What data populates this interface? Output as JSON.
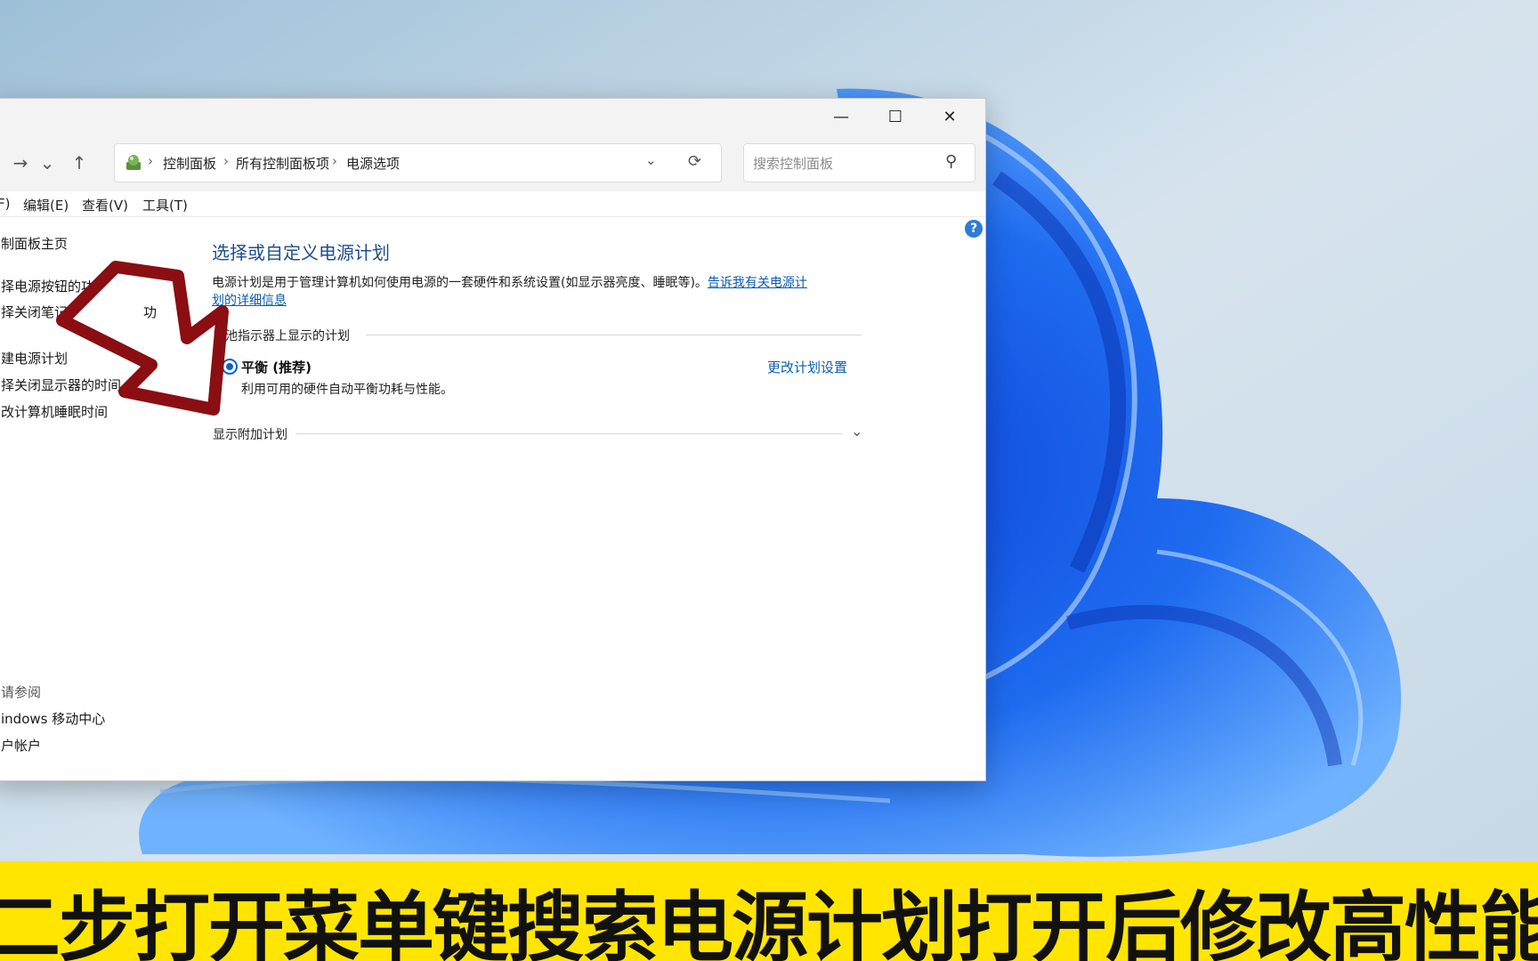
{
  "window": {
    "controls": {
      "minimize": "—",
      "maximize": "☐",
      "close": "✕"
    }
  },
  "nav": {
    "forward": "→",
    "recent": "⌄",
    "up": "↑",
    "address": [
      "控制面板",
      "所有控制面板项",
      "电源选项"
    ],
    "address_sep": "›",
    "dropdown": "⌄",
    "refresh": "⟳",
    "search_placeholder": "搜索控制面板",
    "search_icon": "⚲"
  },
  "menubar": {
    "file_partial": "F)",
    "edit": "编辑(E)",
    "view": "查看(V)",
    "tools": "工具(T)"
  },
  "sidebar": {
    "home": "制面板主页",
    "items": [
      "择电源按钮的功",
      "择关闭笔记",
      "",
      "建电源计划",
      "择关闭显示器的时间",
      "改计算机睡眠时间"
    ],
    "item2_tail": "功",
    "item3_tail": "",
    "see_also_title": "请参阅",
    "see_also": [
      "indows 移动中心",
      "户帐户"
    ]
  },
  "main": {
    "title": "选择或自定义电源计划",
    "desc_line1": "电源计划是用于管理计算机如何使用电源的一套硬件和系统设置(如显示器亮度、睡眠等)。",
    "desc_link1": "告诉我有关电源计",
    "desc_link2": "划的详细信息",
    "battery_group": "电池指示器上显示的计划",
    "plan_name": "平衡 (推荐)",
    "plan_desc": "利用可用的硬件自动平衡功耗与性能。",
    "plan_link": "更改计划设置",
    "additional_group": "显示附加计划",
    "expand_icon": "⌄",
    "help": "?"
  },
  "caption": {
    "text": "二步打开菜单键搜索电源计划打开后修改高性能模"
  }
}
